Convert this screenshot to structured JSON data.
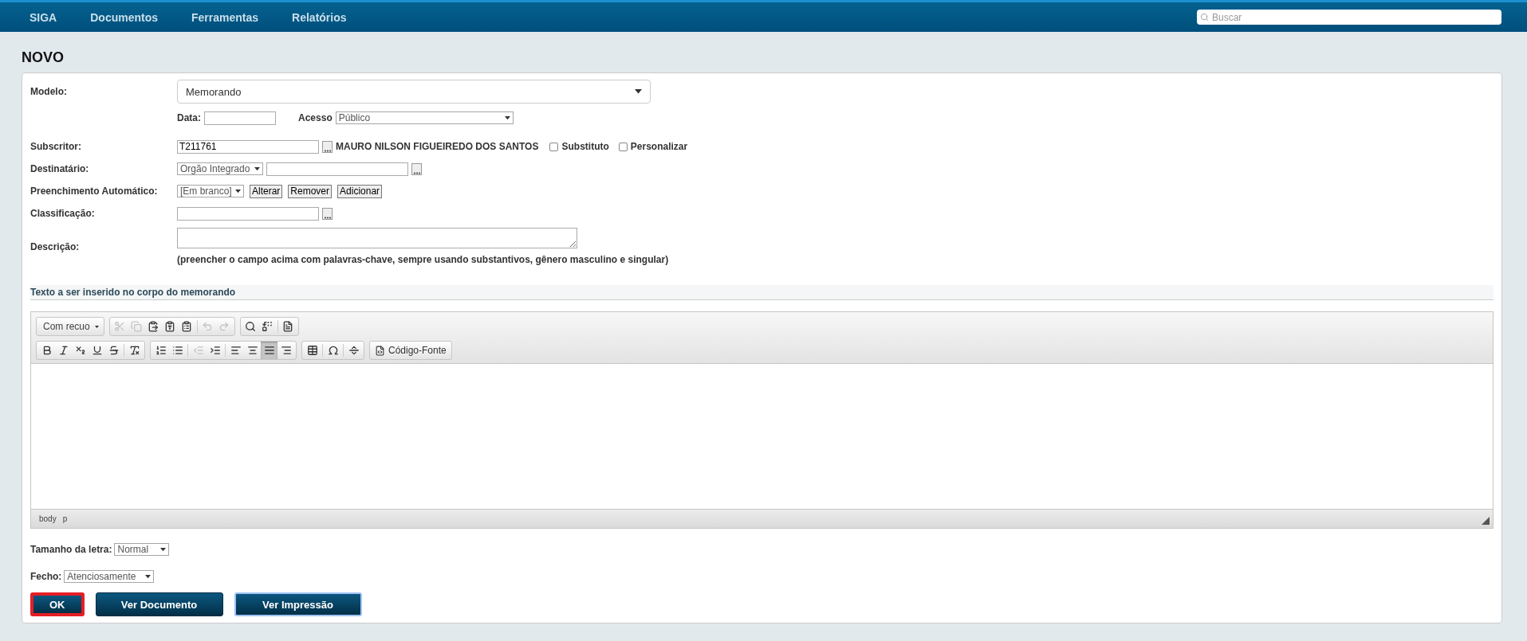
{
  "nav": {
    "items": [
      {
        "label": "SIGA"
      },
      {
        "label": "Documentos"
      },
      {
        "label": "Ferramentas"
      },
      {
        "label": "Relatórios"
      }
    ],
    "search": {
      "placeholder": "Buscar"
    }
  },
  "page": {
    "title": "NOVO"
  },
  "form": {
    "modelo": {
      "label": "Modelo:",
      "value": "Memorando"
    },
    "data": {
      "label": "Data:"
    },
    "acesso": {
      "label": "Acesso",
      "value": "Público"
    },
    "subscritor": {
      "label": "Subscritor:",
      "value": "T211761",
      "name": "MAURO NILSON FIGUEIREDO DOS SANTOS",
      "checks": [
        {
          "label": "Substituto",
          "checked": false
        },
        {
          "label": "Personalizar",
          "checked": false
        }
      ]
    },
    "destinatario": {
      "label": "Destinatário:",
      "select": "Orgão Integrado"
    },
    "preenchimento": {
      "label": "Preenchimento Automático:",
      "select": "[Em branco]",
      "buttons": [
        "Alterar",
        "Remover",
        "Adicionar"
      ]
    },
    "classificacao": {
      "label": "Classificação:"
    },
    "descricao": {
      "label": "Descrição:",
      "hint": "(preencher o campo acima com palavras-chave, sempre usando substantivos, gênero masculino e singular)"
    }
  },
  "editor": {
    "section_title": "Texto a ser inserido no corpo do memorando",
    "format": "Com recuo",
    "rows": [
      [
        [
          [
            {
              "kind": "cut",
              "disabled": true,
              "selected": false
            },
            {
              "kind": "copy",
              "disabled": true,
              "selected": false
            },
            {
              "kind": "paste",
              "disabled": false,
              "selected": false
            },
            {
              "kind": "paste-text",
              "disabled": false,
              "selected": false
            },
            {
              "kind": "paste-word",
              "disabled": false,
              "selected": false
            }
          ],
          [
            {
              "kind": "undo",
              "disabled": true,
              "selected": false
            },
            {
              "kind": "redo",
              "disabled": true,
              "selected": false
            }
          ]
        ],
        [
          [
            {
              "kind": "find",
              "disabled": false,
              "selected": false
            },
            {
              "kind": "replace",
              "disabled": false,
              "selected": false
            }
          ],
          [
            {
              "kind": "page",
              "disabled": false,
              "selected": false
            }
          ]
        ]
      ],
      [
        [
          [
            {
              "kind": "bold",
              "disabled": false,
              "selected": false
            },
            {
              "kind": "italic",
              "disabled": false,
              "selected": false
            },
            {
              "kind": "subscript",
              "disabled": false,
              "selected": false
            },
            {
              "kind": "underline",
              "disabled": false,
              "selected": false
            },
            {
              "kind": "strike",
              "disabled": false,
              "selected": false
            }
          ],
          [
            {
              "kind": "clear",
              "disabled": false,
              "selected": false
            }
          ]
        ],
        [
          [
            {
              "kind": "ol",
              "disabled": false,
              "selected": false
            },
            {
              "kind": "ul",
              "disabled": false,
              "selected": false
            }
          ],
          [
            {
              "kind": "outdent",
              "disabled": true,
              "selected": false
            },
            {
              "kind": "indent",
              "disabled": false,
              "selected": false
            }
          ],
          [
            {
              "kind": "left",
              "disabled": false,
              "selected": false
            },
            {
              "kind": "center",
              "disabled": false,
              "selected": false
            },
            {
              "kind": "justify",
              "disabled": false,
              "selected": true
            },
            {
              "kind": "right",
              "disabled": false,
              "selected": false
            }
          ]
        ],
        [
          [
            {
              "kind": "table",
              "disabled": false,
              "selected": false
            }
          ],
          [
            {
              "kind": "omega",
              "disabled": false,
              "selected": false
            }
          ],
          [
            {
              "kind": "pagebreak",
              "disabled": false,
              "selected": false
            }
          ]
        ]
      ]
    ],
    "source_button": "Código-Fonte",
    "path": [
      "body",
      "p"
    ]
  },
  "tamanho": {
    "label": "Tamanho da letra:",
    "value": "Normal"
  },
  "fecho": {
    "label": "Fecho:",
    "value": "Atenciosamente"
  },
  "buttons": [
    {
      "label": "OK",
      "focused": true,
      "highlighted": false
    },
    {
      "label": "Ver Documento",
      "focused": false,
      "highlighted": false
    },
    {
      "label": "Ver Impressão",
      "focused": false,
      "highlighted": true
    }
  ]
}
